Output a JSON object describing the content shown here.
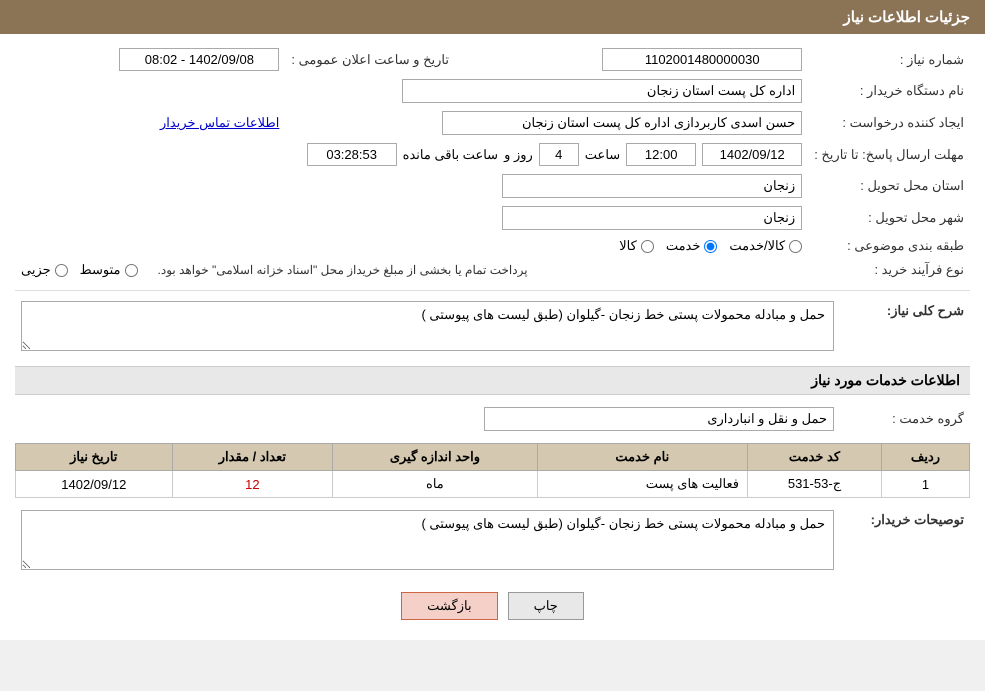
{
  "header": {
    "title": "جزئیات اطلاعات نیاز"
  },
  "fields": {
    "shomara_niaz_label": "شماره نیاز :",
    "shomara_niaz_value": "1102001480000030",
    "nam_dastgah_label": "نام دستگاه خریدار :",
    "nam_dastgah_value": "اداره کل پست استان زنجان",
    "tarikh_saeat_label": "تاریخ و ساعت اعلان عمومی :",
    "tarikh_saeat_value": "1402/09/08 - 08:02",
    "ijad_label": "ایجاد کننده درخواست :",
    "ijad_value": "حسن  اسدی کاربردازی اداره کل پست استان زنجان",
    "ettelaat_link": "اطلاعات تماس خریدار",
    "mohlat_label": "مهلت ارسال پاسخ: تا تاریخ :",
    "mohlat_date": "1402/09/12",
    "mohlat_saeat_label": "ساعت",
    "mohlat_saeat_value": "12:00",
    "mohlat_roz_label": "روز و",
    "mohlat_roz_value": "4",
    "mohlat_baqi_label": "ساعت باقی مانده",
    "mohlat_baqi_value": "03:28:53",
    "ostan_label": "استان محل تحویل :",
    "ostan_value": "زنجان",
    "shahr_label": "شهر محل تحویل :",
    "shahr_value": "زنجان",
    "tabaqe_label": "طبقه بندی موضوعی :",
    "radio_kala": "کالا",
    "radio_khedmat": "خدمت",
    "radio_kala_khedmat": "کالا/خدمت",
    "radio_selected": "khedmat",
    "noue_farayand_label": "نوع فرآیند خرید :",
    "radio_jozvi": "جزیی",
    "radio_motevaset": "متوسط",
    "notice_text": "پرداخت تمام یا بخشی از مبلغ خریداز محل \"اسناد خزانه اسلامی\" خواهد بود.",
    "sharh_label": "شرح کلی نیاز:",
    "sharh_value": "حمل و مبادله محمولات پستی خط زنجان -گیلوان (طبق لیست های پیوستی )",
    "ettelaat_khadamat_title": "اطلاعات خدمات مورد نیاز",
    "grouh_khadamat_label": "گروه خدمت :",
    "grouh_khadamat_value": "حمل و نقل و انبارداری",
    "table_headers": {
      "radif": "ردیف",
      "kod_khadamat": "کد خدمت",
      "nam_khadamat": "نام خدمت",
      "vahid_andaze": "واحد اندازه گیری",
      "tedad_megdar": "تعداد / مقدار",
      "tarikh_niaz": "تاریخ نیاز"
    },
    "table_rows": [
      {
        "radif": "1",
        "kod_khadamat": "ج-53-531",
        "nam_khadamat": "فعالیت های پست",
        "vahid_andaze": "ماه",
        "tedad_megdar": "12",
        "tarikh_niaz": "1402/09/12"
      }
    ],
    "tosifat_label": "توصیحات خریدار:",
    "tosifat_value": "حمل و مبادله محمولات پستی خط زنجان -گیلوان (طبق لیست های پیوستی )",
    "btn_chap": "چاپ",
    "btn_bazgasht": "بازگشت"
  }
}
